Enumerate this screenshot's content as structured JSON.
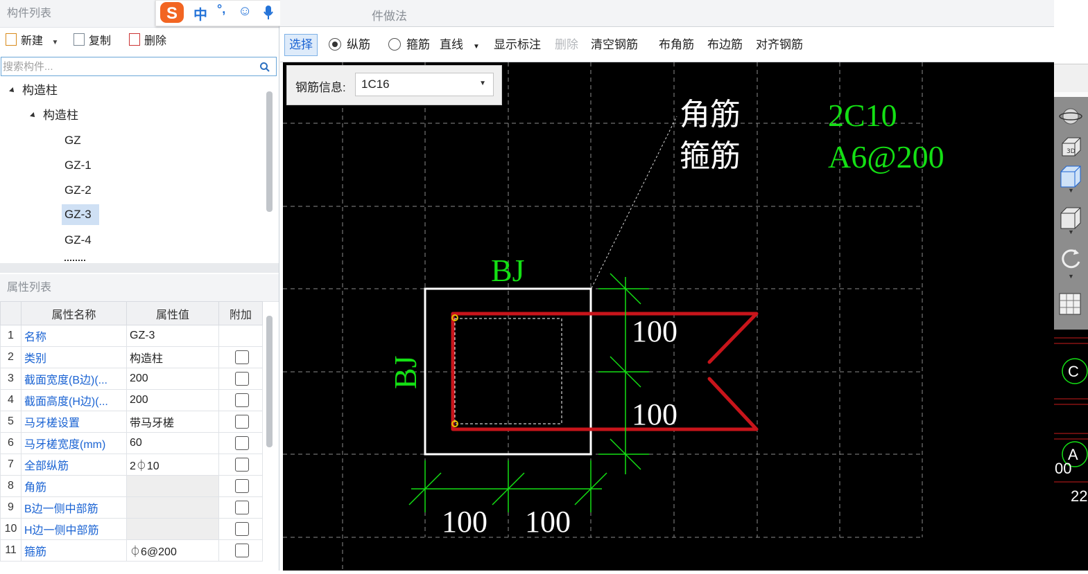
{
  "left_panel": {
    "title": "构件列表",
    "toolbar": {
      "new_label": "新建",
      "copy_label": "复制",
      "delete_label": "删除"
    },
    "search": {
      "placeholder": "搜索构件..."
    },
    "tree": {
      "root": "构造柱",
      "group": "构造柱",
      "items": [
        "GZ",
        "GZ-1",
        "GZ-2",
        "GZ-3",
        "GZ-4"
      ],
      "selected": "GZ-3"
    }
  },
  "property_panel": {
    "title": "属性列表",
    "headers": [
      "属性名称",
      "属性值",
      "附加"
    ],
    "rows": [
      {
        "num": "1",
        "name": "名称",
        "value": "GZ-3",
        "checkbox": false
      },
      {
        "num": "2",
        "name": "类别",
        "value": "构造柱",
        "checkbox": true
      },
      {
        "num": "3",
        "name": "截面宽度(B边)(...",
        "value": "200",
        "checkbox": true
      },
      {
        "num": "4",
        "name": "截面高度(H边)(...",
        "value": "200",
        "checkbox": true
      },
      {
        "num": "5",
        "name": "马牙槎设置",
        "value": "带马牙槎",
        "checkbox": true
      },
      {
        "num": "6",
        "name": "马牙槎宽度(mm)",
        "value": "60",
        "checkbox": true
      },
      {
        "num": "7",
        "name": "全部纵筋",
        "value": "2⏀10",
        "checkbox": true
      },
      {
        "num": "8",
        "name": "角筋",
        "value": "",
        "checkbox": true
      },
      {
        "num": "9",
        "name": "B边一侧中部筋",
        "value": "",
        "checkbox": true
      },
      {
        "num": "10",
        "name": "H边一侧中部筋",
        "value": "",
        "checkbox": true
      },
      {
        "num": "11",
        "name": "箍筋",
        "value": "⏀6@200",
        "checkbox": true
      }
    ]
  },
  "top_tab": {
    "label": "件做法"
  },
  "ime_bar": {
    "chinese_label": "中",
    "punct_label": "°,"
  },
  "rebar_toolbar": {
    "select_label": "选择",
    "longitudinal_label": "纵筋",
    "stirrup_label": "箍筋",
    "line_mode": "直线",
    "show_annotation_label": "显示标注",
    "delete_label": "删除",
    "clear_label": "清空钢筋",
    "corner_label": "布角筋",
    "edge_label": "布边筋",
    "align_label": "对齐钢筋"
  },
  "rebar_info": {
    "label": "钢筋信息:",
    "value": "1C16"
  },
  "drawing": {
    "corner_bar_label": "角筋",
    "stirrup_label": "箍筋",
    "corner_bar_value": "2C10",
    "stirrup_value": "A6@200",
    "bj_top": "BJ",
    "bj_left": "BJ",
    "dim_right_top": "100",
    "dim_right_bottom": "100",
    "dim_bottom_left": "100",
    "dim_bottom_right": "100",
    "colors": {
      "green": "#14e014",
      "white": "#ffffff",
      "red": "#c8151b",
      "yellow": "#e6c200"
    }
  },
  "right_strip": {
    "label_c": "C",
    "label_a": "A",
    "label_00": "00",
    "label_22": "22"
  }
}
